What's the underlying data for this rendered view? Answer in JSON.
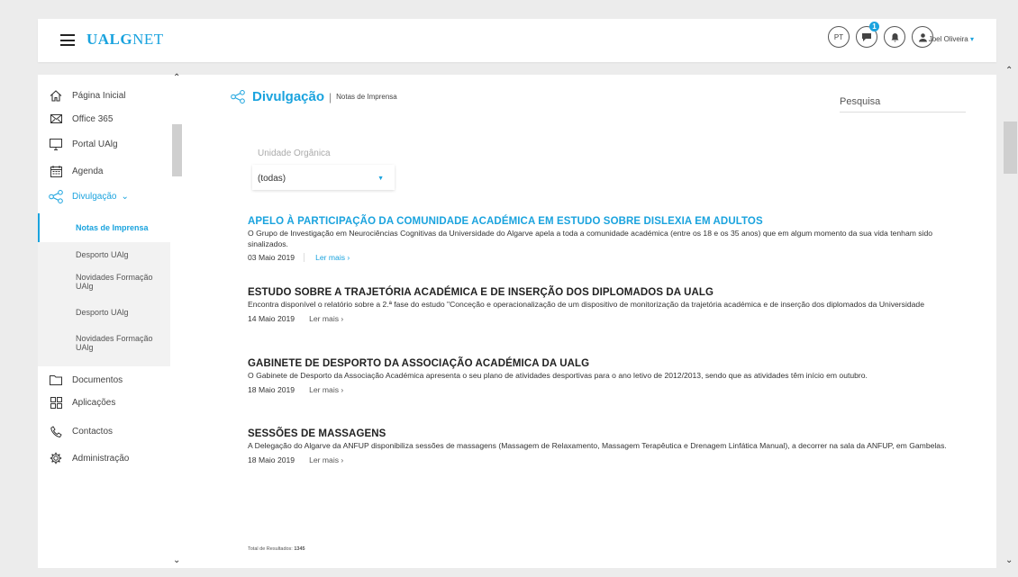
{
  "header": {
    "logo_bold": "UALG",
    "logo_light": "NET",
    "language": "PT",
    "notification_count": "1",
    "user_name": "Joel Oliveira",
    "user_caret": "▾"
  },
  "sidebar": {
    "items": [
      {
        "label": "Página Inicial",
        "icon": "home-icon"
      },
      {
        "label": "Office 365",
        "icon": "mail-icon"
      },
      {
        "label": "Portal UAlg",
        "icon": "monitor-icon"
      },
      {
        "label": "Agenda",
        "icon": "calendar-icon"
      },
      {
        "label": "Divulgação",
        "icon": "share-icon"
      },
      {
        "label": "Documentos",
        "icon": "folder-icon"
      },
      {
        "label": "Aplicações",
        "icon": "apps-icon"
      },
      {
        "label": "Contactos",
        "icon": "phone-icon"
      },
      {
        "label": "Administração",
        "icon": "gear-icon"
      }
    ],
    "divulgacao_caret": "⌄",
    "subitems": [
      {
        "label": "Notas de Imprensa"
      },
      {
        "label": "Desporto UAlg"
      },
      {
        "label": "Novidades Formação UAlg"
      },
      {
        "label": "Desporto UAlg"
      },
      {
        "label": "Novidades Formação UAlg"
      }
    ]
  },
  "page": {
    "title": "Divulgação",
    "separator": "|",
    "subtitle": "Notas de Imprensa",
    "search_placeholder": "Pesquisa",
    "unit_label": "Unidade Orgânica",
    "unit_value": "(todas)",
    "total_label": "Total de Resultados:",
    "total_value": "1345"
  },
  "articles": [
    {
      "title": "APELO À PARTICIPAÇÃO DA COMUNIDADE ACADÉMICA EM ESTUDO SOBRE DISLEXIA EM ADULTOS",
      "description": "O Grupo de Investigação em Neurociências Cognitivas da Universidade do Algarve apela a toda a comunidade académica (entre os 18 e os 35 anos) que em algum momento da sua vida tenham sido sinalizados.",
      "date": "03 Maio 2019",
      "more": "Ler mais ›"
    },
    {
      "title": "ESTUDO SOBRE A TRAJETÓRIA ACADÉMICA E DE INSERÇÃO DOS DIPLOMADOS DA UALG",
      "description": "Encontra disponível o relatório sobre a 2.ª fase do estudo \"Conceção e operacionalização de um dispositivo de monitorização da trajetória académica e de inserção dos diplomados da Universidade",
      "date": "14 Maio 2019",
      "more": "Ler mais ›"
    },
    {
      "title": "GABINETE DE DESPORTO DA ASSOCIAÇÃO ACADÉMICA DA UALG",
      "description": "O Gabinete de Desporto da Associação Académica apresenta o seu plano de atividades desportivas para o ano letivo de 2012/2013, sendo que as atividades têm início em outubro.",
      "date": "18 Maio 2019",
      "more": "Ler mais ›"
    },
    {
      "title": "SESSÕES DE MASSAGENS",
      "description": "A Delegação do Algarve da ANFUP disponibiliza sessões de massagens (Massagem de Relaxamento, Massagem Terapêutica e Drenagem Linfática Manual), a decorrer na sala da ANFUP, em Gambelas.",
      "date": "18 Maio 2019",
      "more": "Ler mais ›"
    }
  ],
  "colors": {
    "accent": "#1aa3de",
    "background": "#ececec"
  }
}
